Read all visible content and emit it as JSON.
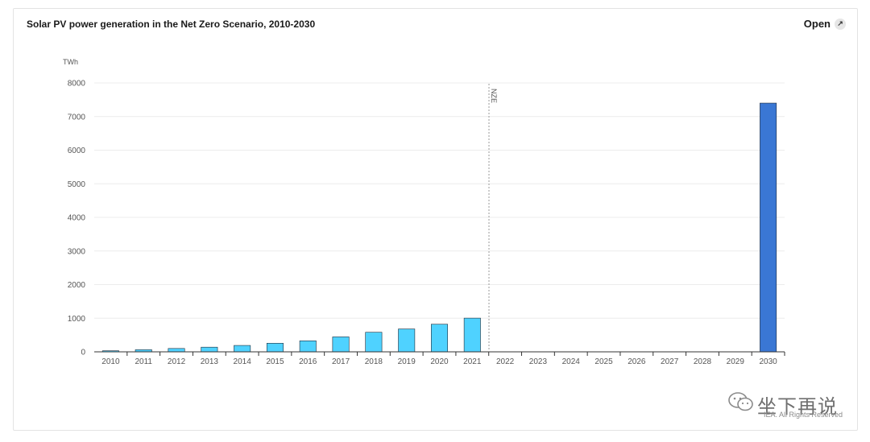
{
  "header": {
    "title": "Solar PV power generation in the Net Zero Scenario, 2010-2030",
    "open_label": "Open",
    "open_icon": "external-link-icon"
  },
  "footer": {
    "copyright": "IEA. All Rights Reserved",
    "watermark": "坐下再说",
    "watermark_icon": "wechat-icon"
  },
  "chart_data": {
    "type": "bar",
    "title": "Solar PV power generation in the Net Zero Scenario, 2010-2030",
    "ylabel": "TWh",
    "xlabel": "",
    "ylim": [
      0,
      8000
    ],
    "yticks": [
      0,
      1000,
      2000,
      3000,
      4000,
      5000,
      6000,
      7000,
      8000
    ],
    "categories": [
      "2010",
      "2011",
      "2012",
      "2013",
      "2014",
      "2015",
      "2016",
      "2017",
      "2018",
      "2019",
      "2020",
      "2021",
      "2022",
      "2023",
      "2024",
      "2025",
      "2026",
      "2027",
      "2028",
      "2029",
      "2030"
    ],
    "values": [
      32,
      63,
      100,
      139,
      190,
      256,
      328,
      445,
      582,
      680,
      821,
      1003,
      null,
      null,
      null,
      null,
      null,
      null,
      null,
      null,
      7400
    ],
    "historical_color": "#4fd2ff",
    "projection_color": "#3a77d4",
    "marker": {
      "label": "NZE",
      "between": [
        "2021",
        "2022"
      ]
    },
    "grid": true
  }
}
